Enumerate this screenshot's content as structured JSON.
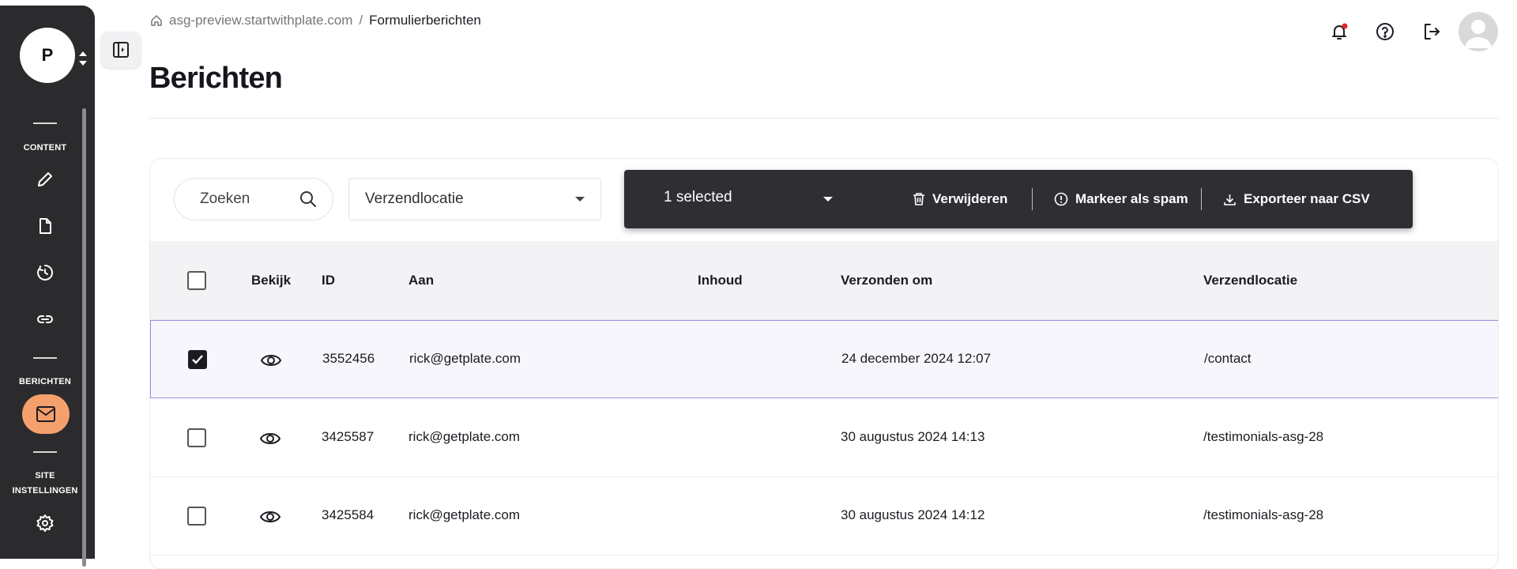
{
  "sidebar": {
    "workspace_initial": "P",
    "sections": {
      "content": "CONTENT",
      "berichten": "BERICHTEN",
      "site_settings_line1": "SITE",
      "site_settings_line2": "INSTELLINGEN"
    },
    "icons": [
      "pencil-icon",
      "document-icon",
      "history-icon",
      "link-icon",
      "mail-icon",
      "gear-icon"
    ],
    "active_item": "mail-icon",
    "active_color": "#f5a06c"
  },
  "breadcrumb": {
    "site": "asg-preview.startwithplate.com",
    "separator": "/",
    "current": "Formulierberichten"
  },
  "page_title": "Berichten",
  "toolbar": {
    "search_placeholder": "Zoeken",
    "location_select": "Verzendlocatie",
    "bulk": {
      "selected_label": "1 selected",
      "delete_label": "Verwijderen",
      "spam_label": "Markeer als spam",
      "export_label": "Exporteer naar CSV"
    }
  },
  "table": {
    "columns": {
      "view": "Bekijk",
      "id": "ID",
      "to": "Aan",
      "content": "Inhoud",
      "sent_at": "Verzonden om",
      "location": "Verzendlocatie"
    },
    "rows": [
      {
        "checked": true,
        "id": "3552456",
        "to": "rick@getplate.com",
        "content": "",
        "sent_at": "24 december 2024 12:07",
        "location": "/contact"
      },
      {
        "checked": false,
        "id": "3425587",
        "to": "rick@getplate.com",
        "content": "",
        "sent_at": "30 augustus 2024 14:13",
        "location": "/testimonials-asg-28"
      },
      {
        "checked": false,
        "id": "3425584",
        "to": "rick@getplate.com",
        "content": "",
        "sent_at": "30 augustus 2024 14:12",
        "location": "/testimonials-asg-28"
      }
    ]
  },
  "colors": {
    "sidebar_bg": "#2b2b2e",
    "selected_row_border": "#a98be4",
    "notification_dot": "#e0252a"
  }
}
